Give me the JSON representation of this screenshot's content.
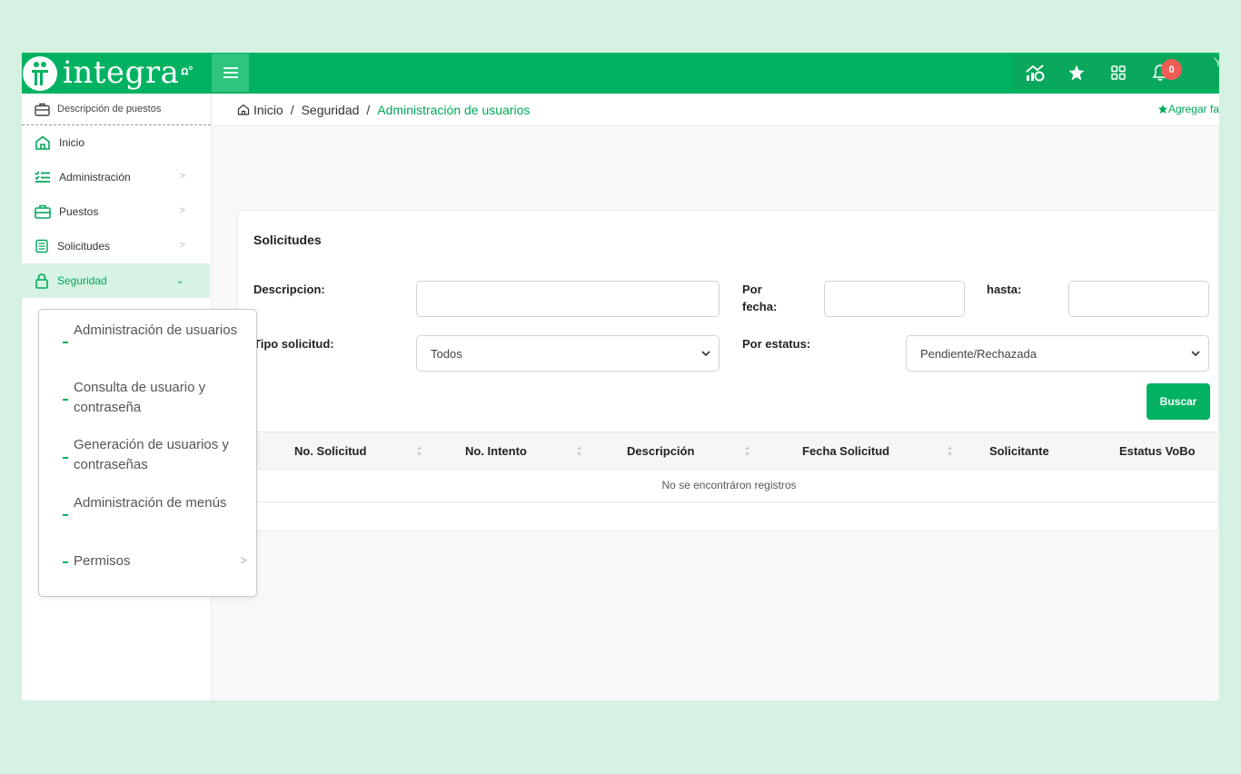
{
  "topbar": {
    "logo_text": "integra",
    "logo_mark": "ꭥ°",
    "notifications_count": "0",
    "user_initial": "Y",
    "icons": [
      "stats-icon",
      "star-icon",
      "apps-grid-icon",
      "bell-icon"
    ],
    "brand_color": "#00b262"
  },
  "sidebar": {
    "top_label": "Descripción de puestos",
    "items": [
      {
        "label": "Inicio",
        "icon": "home-icon",
        "has_children": false
      },
      {
        "label": "Administración",
        "icon": "checklist-icon",
        "has_children": true
      },
      {
        "label": "Puestos",
        "icon": "briefcase-icon",
        "has_children": true
      },
      {
        "label": "Solicitudes",
        "icon": "clipboard-icon",
        "has_children": true
      },
      {
        "label": "Seguridad",
        "icon": "lock-icon",
        "has_children": true,
        "active": true
      }
    ]
  },
  "submenu": {
    "items": [
      {
        "label": "Administración de usuarios"
      },
      {
        "label": "Consulta de usuario y contraseña"
      },
      {
        "label": "Generación de usuarios y contraseñas"
      },
      {
        "label": "Administración de menús"
      },
      {
        "label": "Permisos",
        "has_children": true
      }
    ]
  },
  "breadcrumb": {
    "home": "Inicio",
    "section": "Seguridad",
    "current": "Administración de usuarios",
    "add_favorite": "Agregar fa"
  },
  "form": {
    "title": "Solicitudes",
    "descripcion_label": "Descripcion:",
    "descripcion_value": "",
    "por_fecha_label_1": "Por",
    "por_fecha_label_2": "fecha:",
    "fecha_desde_value": "",
    "hasta_label": "hasta:",
    "fecha_hasta_value": "",
    "tipo_label": "Tipo solicitud:",
    "tipo_value": "Todos",
    "estatus_label": "Por estatus:",
    "estatus_value": "Pendiente/Rechazada",
    "buscar_label": "Buscar"
  },
  "table": {
    "columns": [
      "No. Solicitud",
      "No. Intento",
      "Descripción",
      "Fecha Solicitud",
      "Solicitante",
      "Estatus VoBo"
    ],
    "empty_message": "No se encontráron registros"
  }
}
